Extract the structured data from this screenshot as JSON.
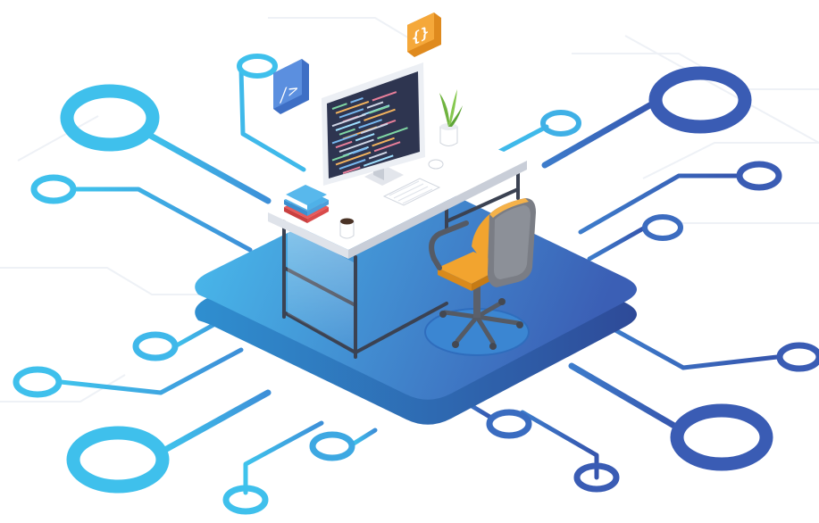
{
  "illustration": {
    "code_badge_glyph": "/>",
    "braces_badge_glyph": "{}",
    "colors": {
      "background": "#ffffff",
      "circuit_light": "#3dbde8",
      "circuit_dark": "#3a5db4",
      "platform_light": "#45b3ea",
      "platform_dark": "#3e63b8",
      "desk_top": "#f4f5f7",
      "desk_frame": "#3b4252",
      "monitor_screen": "#2e3550",
      "chair_seat": "#f2a42f",
      "chair_back": "#7a7d85",
      "braces_badge": "#f5a83a",
      "code_badge": "#5b8fdf",
      "plant": "#7cc04a",
      "book_red": "#e55050",
      "book_blue": "#4aa6e0"
    },
    "icons": [
      "code-tag-icon",
      "curly-braces-icon",
      "monitor-icon",
      "keyboard-icon",
      "mouse-icon",
      "coffee-mug-icon",
      "books-icon",
      "plant-icon",
      "office-chair-icon"
    ]
  }
}
